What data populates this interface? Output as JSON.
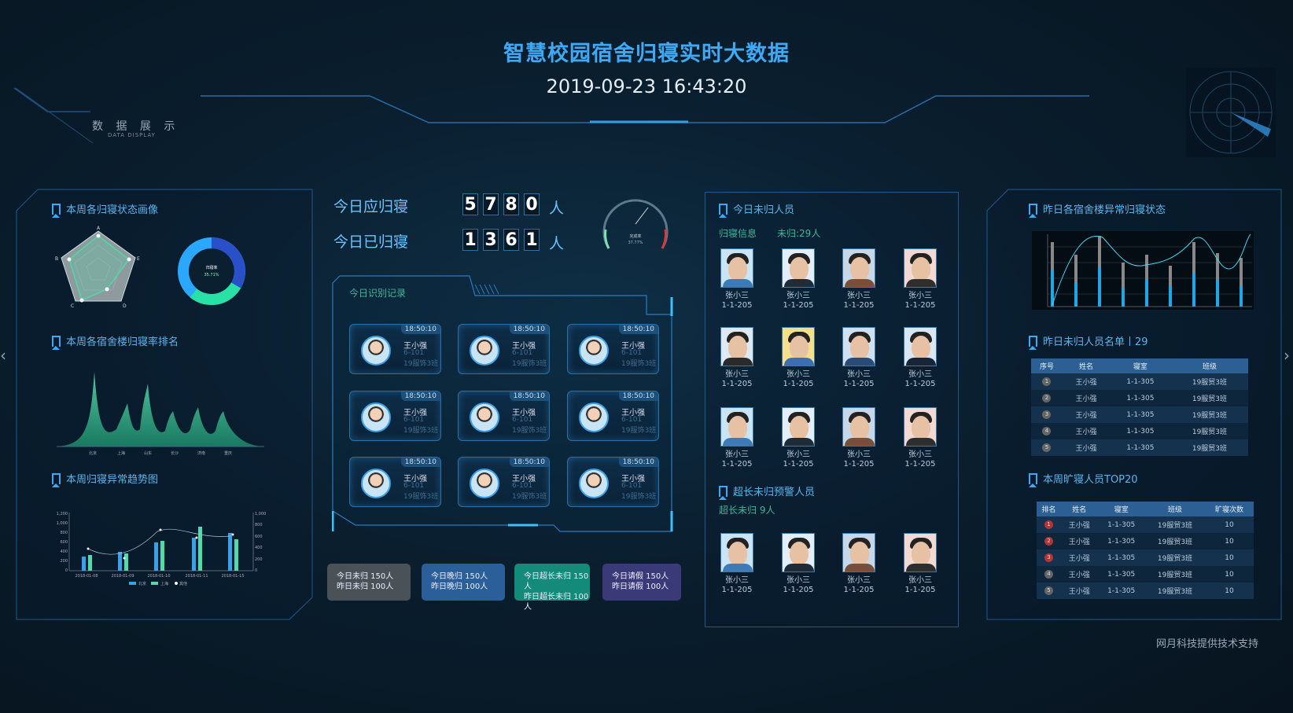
{
  "header": {
    "title": "智慧校园宿舍归寝实时大数据",
    "clock": "2019-09-23 16:43:20",
    "brand": "数 据 展 示",
    "brand_sub": "DATA DISPLAY",
    "footer": "网月科技提供技术支持"
  },
  "left": {
    "radar_title": "本周各归寝状态画像",
    "radar_labels": [
      "A",
      "E",
      "D",
      "C",
      "B"
    ],
    "donut_center_label": "归寝率",
    "donut_center_value": "35.71%",
    "rank_title": "本周各宿舍楼归寝率排名",
    "rank_categories": [
      "北京",
      "上海",
      "山东",
      "长沙",
      "济南",
      "重庆"
    ],
    "trend_title": "本周归寝异常趋势图",
    "trend_left_ticks": [
      "1,200",
      "1,000",
      "800",
      "600",
      "400",
      "200",
      "0"
    ],
    "trend_right_ticks": [
      "1,000",
      "800",
      "600",
      "400",
      "200",
      "0"
    ],
    "trend_dates": [
      "2018-01-08",
      "2018-01-09",
      "2018-01-10",
      "2018-01-11",
      "2018-01-15"
    ],
    "trend_legend": [
      "北京",
      "上海",
      "其他"
    ]
  },
  "center": {
    "due_label": "今日应归寝",
    "due_digits": [
      "5",
      "7",
      "8",
      "0"
    ],
    "returned_label": "今日已归寝",
    "returned_digits": [
      "1",
      "3",
      "6",
      "1"
    ],
    "unit": "人",
    "gauge_label": "完成率",
    "gauge_value": "37.77%",
    "records_title": "今日识别记录",
    "records": [
      {
        "time": "18:50:10",
        "name": "王小强",
        "room": "6-101",
        "class": "19服饰3班"
      },
      {
        "time": "18:50:10",
        "name": "王小强",
        "room": "6-101",
        "class": "19服饰3班"
      },
      {
        "time": "18:50:10",
        "name": "王小强",
        "room": "6-101",
        "class": "19服饰3班"
      },
      {
        "time": "18:50:10",
        "name": "王小强",
        "room": "6-101",
        "class": "19服饰3班"
      },
      {
        "time": "18:50:10",
        "name": "王小强",
        "room": "6-101",
        "class": "19服饰3班"
      },
      {
        "time": "18:50:10",
        "name": "王小强",
        "room": "6-101",
        "class": "19服饰3班"
      },
      {
        "time": "18:50:10",
        "name": "王小强",
        "room": "6-101",
        "class": "19服饰3班"
      },
      {
        "time": "18:50:10",
        "name": "王小强",
        "room": "6-101",
        "class": "19服饰3班"
      },
      {
        "time": "18:50:10",
        "name": "王小强",
        "room": "6-101",
        "class": "19服饰3班"
      }
    ],
    "stats": [
      {
        "line1": "今日未归  150人",
        "line2": "昨日未归  100人",
        "color": "#4a5258"
      },
      {
        "line1": "今日晚归  150人",
        "line2": "昨日晚归  100人",
        "color": "#2b5f99"
      },
      {
        "line1": "今日超长未归  150人",
        "line2": "昨日超长未归  100人",
        "color": "#138a7a"
      },
      {
        "line1": "今日请假  150人",
        "line2": "昨日请假  100人",
        "color": "#3b3a78"
      }
    ]
  },
  "absent": {
    "title": "今日未归人员",
    "info_label": "归寝信息",
    "count_label": "未归:29人",
    "people": [
      {
        "name": "张小三",
        "room": "1-1-205"
      },
      {
        "name": "张小三",
        "room": "1-1-205"
      },
      {
        "name": "张小三",
        "room": "1-1-205"
      },
      {
        "name": "张小三",
        "room": "1-1-205"
      },
      {
        "name": "张小三",
        "room": "1-1-205"
      },
      {
        "name": "张小三",
        "room": "1-1-205"
      },
      {
        "name": "张小三",
        "room": "1-1-205"
      },
      {
        "name": "张小三",
        "room": "1-1-205"
      },
      {
        "name": "张小三",
        "room": "1-1-205"
      },
      {
        "name": "张小三",
        "room": "1-1-205"
      },
      {
        "name": "张小三",
        "room": "1-1-205"
      },
      {
        "name": "张小三",
        "room": "1-1-205"
      }
    ],
    "warn_title": "超长未归预警人员",
    "warn_label": "超长未归  9人",
    "warn_people": [
      {
        "name": "张小三",
        "room": "1-1-205"
      },
      {
        "name": "张小三",
        "room": "1-1-205"
      },
      {
        "name": "张小三",
        "room": "1-1-205"
      },
      {
        "name": "张小三",
        "room": "1-1-205"
      }
    ]
  },
  "right": {
    "chart_title": "昨日各宿舍楼异常归寝状态",
    "list_title": "昨日未归人员名单丨29",
    "list_headers": [
      "序号",
      "姓名",
      "寝室",
      "班级"
    ],
    "list_rows": [
      [
        "1",
        "王小强",
        "1-1-305",
        "19服贸3班"
      ],
      [
        "2",
        "王小强",
        "1-1-305",
        "19服贸3班"
      ],
      [
        "3",
        "王小强",
        "1-1-305",
        "19服贸3班"
      ],
      [
        "4",
        "王小强",
        "1-1-305",
        "19服贸3班"
      ],
      [
        "5",
        "王小强",
        "1-1-305",
        "19服贸3班"
      ]
    ],
    "top_title": "本周旷寝人员TOP20",
    "top_headers": [
      "排名",
      "姓名",
      "寝室",
      "班级",
      "旷寝次数"
    ],
    "top_rows": [
      [
        "1",
        "王小强",
        "1-1-305",
        "19服贸3班",
        "10"
      ],
      [
        "2",
        "王小强",
        "1-1-305",
        "19服贸3班",
        "10"
      ],
      [
        "3",
        "王小强",
        "1-1-305",
        "19服贸3班",
        "10"
      ],
      [
        "4",
        "王小强",
        "1-1-305",
        "19服贸3班",
        "10"
      ],
      [
        "5",
        "王小强",
        "1-1-305",
        "19服贸3班",
        "10"
      ]
    ]
  },
  "colors": {
    "accent": "#3fa9f5",
    "green": "#4fd8a4",
    "panel_border": "#1f5a8c"
  }
}
